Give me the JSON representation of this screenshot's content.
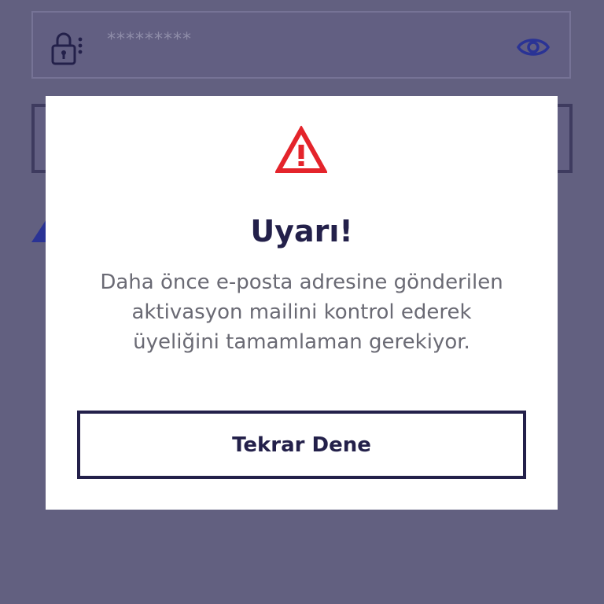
{
  "background": {
    "password_field": {
      "value": "*********",
      "lock_icon": "lock-icon",
      "visibility_icon": "eye-icon"
    }
  },
  "dialog": {
    "icon": "warning-triangle-icon",
    "title": "Uyarı!",
    "message": "Daha önce e-posta adresine gönderilen aktivasyon mailini kontrol ederek üyeliğini tamamlaman gerekiyor.",
    "button_label": "Tekrar Dene"
  },
  "colors": {
    "overlay": "#626080",
    "primary_dark": "#23204a",
    "warning_red": "#e4242b",
    "accent_blue": "#2a3395"
  }
}
